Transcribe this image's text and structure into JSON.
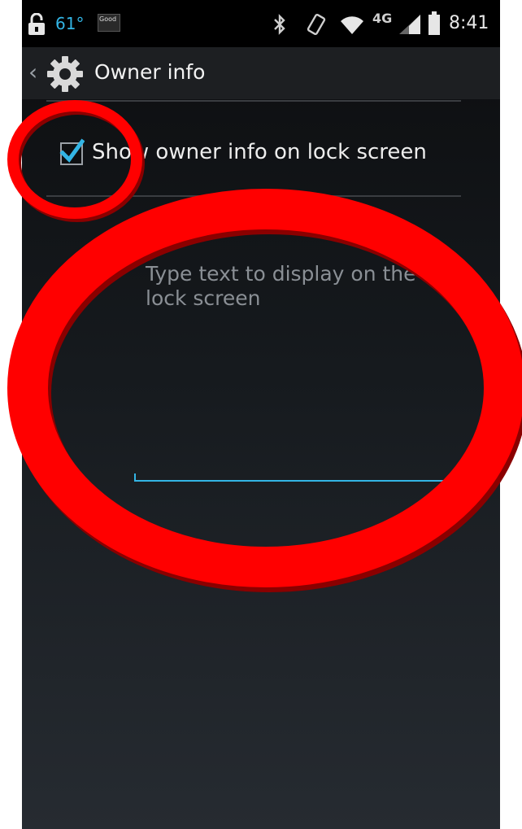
{
  "status_bar": {
    "temperature": "61°",
    "weather": "Good",
    "network": "4G",
    "time": "8:41",
    "icons": [
      "lock-open-icon",
      "weather-icon",
      "bluetooth-icon",
      "vibrate-icon",
      "wifi-icon",
      "signal-icon",
      "battery-icon"
    ]
  },
  "action_bar": {
    "title": "Owner info",
    "back_icon": "chevron-left-icon",
    "app_icon": "settings-gear-icon"
  },
  "settings": {
    "show_owner_info_label": "Show owner info on lock screen",
    "show_owner_info_checked": true
  },
  "owner_info_field": {
    "placeholder": "Type text to display on the lock screen",
    "value": ""
  },
  "colors": {
    "accent": "#33b5e5",
    "annotation": "#ff0000"
  }
}
